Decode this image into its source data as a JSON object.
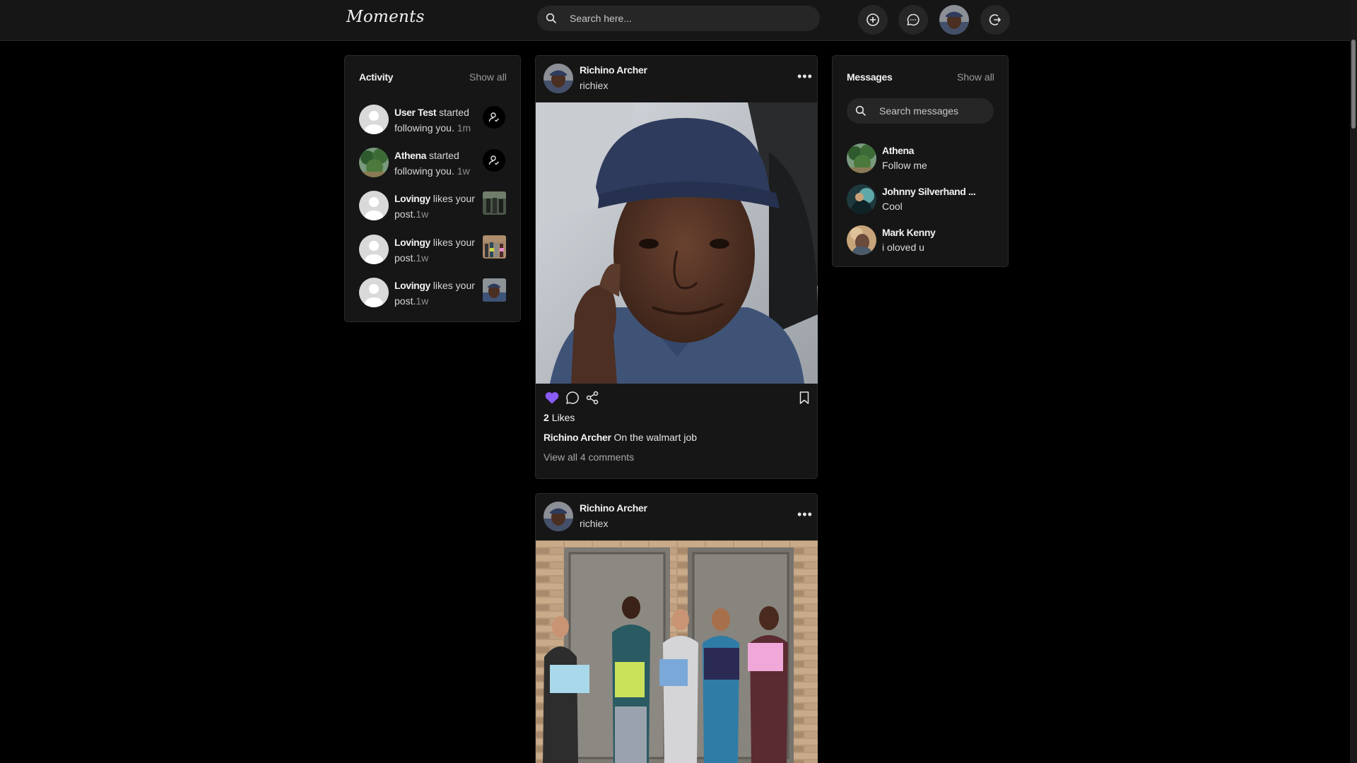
{
  "app": {
    "title": "Moments"
  },
  "search": {
    "placeholder": "Search here..."
  },
  "topbar": {
    "icons": [
      "plus-circle-icon",
      "chat-bubble-icon",
      "user-avatar",
      "logout-icon"
    ]
  },
  "activity": {
    "title": "Activity",
    "show_all": "Show all",
    "items": [
      {
        "user": "User Test",
        "text": " started following you.",
        "time": " 1m",
        "kind": "follow",
        "avatar": "default"
      },
      {
        "user": "Athena",
        "text": " started following you.",
        "time": " 1w",
        "kind": "follow",
        "avatar": "trees"
      },
      {
        "user": "Lovingy",
        "text": " likes your post.",
        "time": "1w",
        "kind": "like",
        "avatar": "default"
      },
      {
        "user": "Lovingy",
        "text": " likes your post.",
        "time": "1w",
        "kind": "like",
        "avatar": "default"
      },
      {
        "user": "Lovingy",
        "text": " likes your post.",
        "time": "1w",
        "kind": "like",
        "avatar": "default"
      }
    ]
  },
  "posts": [
    {
      "author": "Richino Archer",
      "username": "richiex",
      "likes_count": "2",
      "likes_label": "Likes",
      "caption_author": "Richino Archer",
      "caption": " On the walmart job",
      "comments_link": "View all 4 comments",
      "liked": true,
      "image": "selfie-photo"
    },
    {
      "author": "Richino Archer",
      "username": "richiex",
      "image": "group-photo"
    }
  ],
  "messages": {
    "title": "Messages",
    "show_all": "Show all",
    "search_placeholder": "Search messages",
    "items": [
      {
        "name": "Athena",
        "text": "Follow me",
        "avatar": "trees"
      },
      {
        "name": "Johnny Silverhand ...",
        "text": "Cool",
        "avatar": "teal"
      },
      {
        "name": "Mark Kenny",
        "text": "i oloved u",
        "avatar": "warm"
      }
    ]
  },
  "colors": {
    "background": "#000000",
    "surface": "#161616",
    "accent_like": "#8a5cf6",
    "muted_text": "#9c9c9c"
  }
}
